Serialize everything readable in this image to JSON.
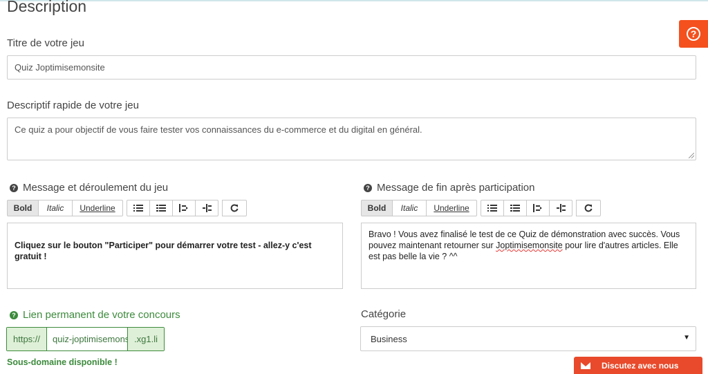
{
  "section": {
    "title": "Description"
  },
  "help": {
    "label": "?"
  },
  "game_title": {
    "label": "Titre de votre jeu",
    "value": "Quiz Joptimisemonsite"
  },
  "short_desc": {
    "label": "Descriptif rapide de votre jeu",
    "value": "Ce quiz a pour objectif de vous faire tester vos connaissances du e-commerce et du digital en général."
  },
  "toolbar": {
    "bold": "Bold",
    "italic": "Italic",
    "underline": "Underline",
    "icons": [
      "unordered-list-icon",
      "ordered-list-icon",
      "outdent-icon",
      "indent-icon",
      "undo-icon"
    ]
  },
  "message_game": {
    "label": "Message et déroulement du jeu",
    "content": "Cliquez sur le bouton \"Participer\" pour démarrer votre test - allez-y c'est gratuit !"
  },
  "message_end": {
    "label": "Message de fin après participation",
    "content_before": "Bravo !  Vous avez finalisé le test de ce Quiz de démonstration avec succès. Vous pouvez maintenant retourner sur ",
    "content_link": "Joptimisemonsite",
    "content_after": " pour lire d'autres articles. Elle est pas belle la vie ? ^^"
  },
  "permalink": {
    "label": "Lien permanent de votre concours",
    "prefix": "https://",
    "value": "quiz-joptimisemonsite",
    "suffix": ".xg1.li",
    "status": "Sous-domaine disponible !"
  },
  "category": {
    "label": "Catégorie",
    "selected": "Business"
  },
  "chat": {
    "label": "Discutez avec nous"
  },
  "colors": {
    "accent": "#f4511e",
    "success": "#3c8a3c",
    "chat": "#e84a2b"
  }
}
